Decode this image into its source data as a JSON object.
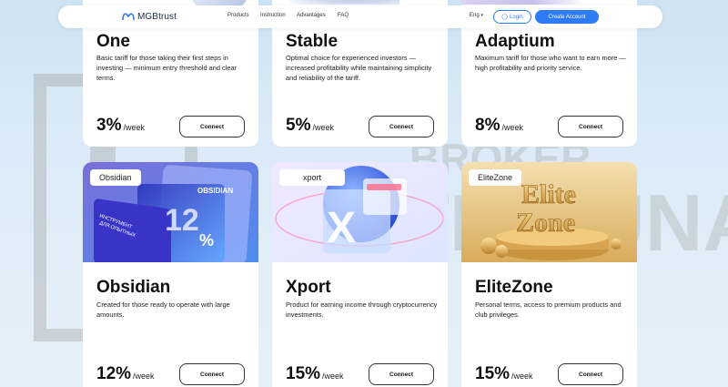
{
  "nav": {
    "brand": "MGBtrust",
    "links": [
      "Products",
      "Instruction",
      "Advantages",
      "FAQ"
    ],
    "lang": "Eng",
    "login": "Login",
    "create": "Create Account"
  },
  "watermark": {
    "text1": "BROKER",
    "text2": "TRIBUNAL"
  },
  "cards": [
    {
      "title": "One",
      "desc": "Basic tariff for those taking their first steps in investing — minimum entry threshold and clear terms.",
      "rate": "3%",
      "unit": "/week",
      "button": "Connect"
    },
    {
      "title": "Stable",
      "desc": "Optimal choice for experienced investors — increased profitability while maintaining simplicity and reliability of the tariff.",
      "rate": "5%",
      "unit": "/week",
      "button": "Connect"
    },
    {
      "title": "Adaptium",
      "desc": "Maximum tariff for those who want to earn more — high profitability and priority service.",
      "rate": "8%",
      "unit": "/week",
      "button": "Connect"
    },
    {
      "title": "Obsidian",
      "tag": "Obsidian",
      "desc": "Created for those ready to operate with large amounts.",
      "rate": "12%",
      "unit": "/week",
      "button": "Connect",
      "image_text": {
        "brand": "OBSIDIAN",
        "percent": "12",
        "percent_sign": "%",
        "line1": "ИНСТРУМЕНТ",
        "line2": "ДЛЯ ОПЫТНЫХ"
      }
    },
    {
      "title": "Xport",
      "tag": "xport",
      "desc": "Product for earning income through cryptocurrency investments.",
      "rate": "15%",
      "unit": "/week",
      "button": "Connect",
      "image_text": {
        "letter": "X"
      }
    },
    {
      "title": "EliteZone",
      "tag": "EliteZone",
      "desc": "Personal terms, access to premium products and club privileges.",
      "rate": "15%",
      "unit": "/week",
      "button": "Connect",
      "image_text": {
        "line1": "Elite",
        "line2": "Zone"
      }
    }
  ]
}
